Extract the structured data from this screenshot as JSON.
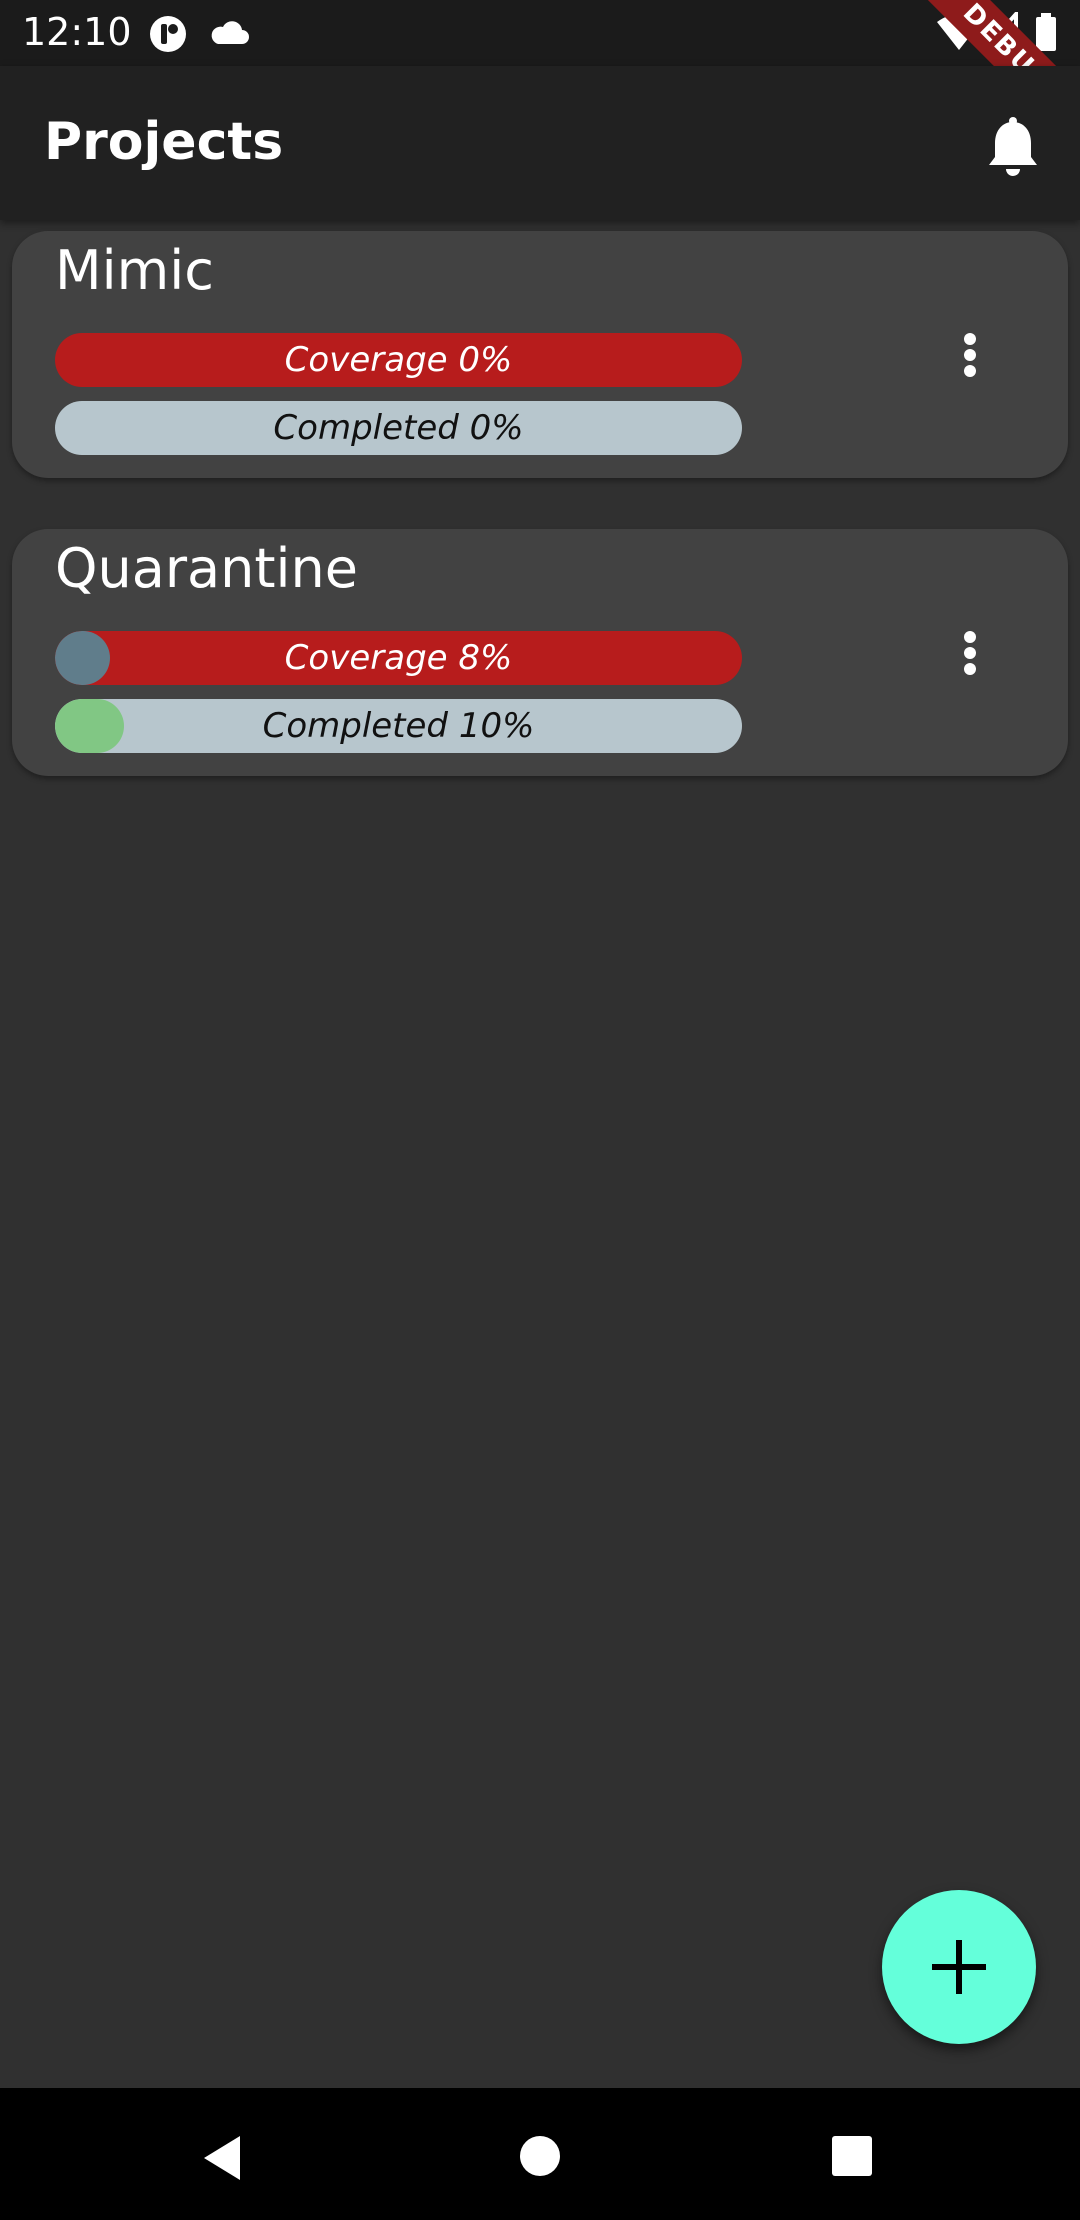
{
  "status_bar": {
    "time": "12:10",
    "icons": [
      "app-notification-icon",
      "cloud-icon",
      "wifi-icon",
      "signal-icon",
      "battery-icon"
    ],
    "debug_banner": "DEBUG"
  },
  "app_bar": {
    "title": "Projects",
    "action_icon": "bell-icon"
  },
  "projects": [
    {
      "name": "Mimic",
      "coverage_label": "Coverage 0%",
      "coverage": 0,
      "completed_label": "Completed 0%",
      "completed": 0
    },
    {
      "name": "Quarantine",
      "coverage_label": "Coverage 8%",
      "coverage": 8,
      "completed_label": "Completed 10%",
      "completed": 10
    }
  ],
  "fab": {
    "icon": "plus-icon"
  },
  "nav_bar": {
    "icons": [
      "back-icon",
      "home-icon",
      "recents-icon"
    ]
  },
  "colors": {
    "background": "#303030",
    "app_bar": "#212121",
    "card": "#424242",
    "coverage_track": "#b71c1c",
    "coverage_fill": "#607d8b",
    "completed_track": "#b7c6cd",
    "completed_fill": "#81c784",
    "fab": "#64ffda",
    "debug_banner": "#8e1b1b"
  }
}
